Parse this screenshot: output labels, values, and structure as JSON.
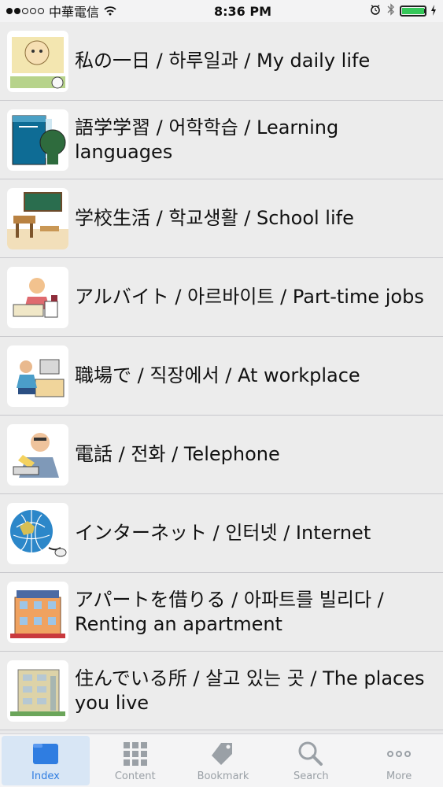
{
  "status": {
    "carrier": "中華電信",
    "time": "8:36 PM"
  },
  "items": [
    {
      "label": "私の一日 / 하루일과 / My daily life",
      "icon": "daily-life-illustration"
    },
    {
      "label": "語学学習 / 어학학습 / Learning languages",
      "icon": "english-book-illustration"
    },
    {
      "label": "学校生活 / 학교생활 / School life",
      "icon": "classroom-illustration"
    },
    {
      "label": "アルバイト / 아르바이트 / Part-time jobs",
      "icon": "cashier-illustration"
    },
    {
      "label": "職場で / 직장에서 / At workplace",
      "icon": "office-worker-illustration"
    },
    {
      "label": "電話 / 전화 / Telephone",
      "icon": "telephone-illustration"
    },
    {
      "label": "インターネット / 인터넷 / Internet",
      "icon": "internet-globe-illustration"
    },
    {
      "label": "アパートを借りる / 아파트를 빌리다 / Renting an apartment",
      "icon": "apartment-illustration"
    },
    {
      "label": "住んでいる所 / 살고 있는 곳 / The places you live",
      "icon": "building-illustration"
    }
  ],
  "tabs": [
    {
      "label": "Index",
      "active": true,
      "icon": "index-icon"
    },
    {
      "label": "Content",
      "active": false,
      "icon": "content-grid-icon"
    },
    {
      "label": "Bookmark",
      "active": false,
      "icon": "bookmark-tag-icon"
    },
    {
      "label": "Search",
      "active": false,
      "icon": "search-icon"
    },
    {
      "label": "More",
      "active": false,
      "icon": "more-icon"
    }
  ],
  "colors": {
    "accent": "#2f7de1",
    "battery": "#35c759"
  }
}
